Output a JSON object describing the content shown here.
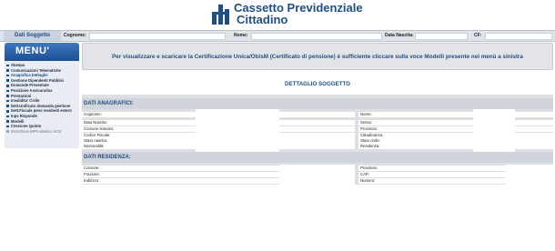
{
  "app": {
    "title_line1": "Cassetto Previdenziale",
    "title_line2": "Cittadino"
  },
  "searchbar": {
    "tab_label": "Dati Soggetto",
    "fields": [
      {
        "label": "Cognome:",
        "value": ""
      },
      {
        "label": "Nome:",
        "value": ""
      },
      {
        "label": "Data Nascita:",
        "value": ""
      },
      {
        "label": "CF:",
        "value": ""
      }
    ]
  },
  "sidebar": {
    "title": "MENU'",
    "items": [
      {
        "label": "Stampa",
        "state": "normal"
      },
      {
        "label": "Comunicazioni Telematiche",
        "state": "normal"
      },
      {
        "label": "Anagrafica Dettaglio",
        "state": "active"
      },
      {
        "label": "Gestione Dipendenti Pubblici",
        "state": "normal"
      },
      {
        "label": "Domande Presentate",
        "state": "normal"
      },
      {
        "label": "Posizione Assicurativa",
        "state": "normal"
      },
      {
        "label": "Prestazioni",
        "state": "normal"
      },
      {
        "label": "Invalidita' Civile",
        "state": "normal"
      },
      {
        "label": "Dett.Unificato domanda gestione",
        "state": "normal"
      },
      {
        "label": "Dett.Fiscale pens residenti estero",
        "state": "normal"
      },
      {
        "label": "Inps Risponde",
        "state": "normal"
      },
      {
        "label": "Modelli",
        "state": "normal"
      },
      {
        "label": "Cessione Quinto",
        "state": "normal"
      },
      {
        "label": "Estrattore INPS-Medici ACN",
        "state": "disabled"
      }
    ]
  },
  "notice": "Per visualizzare e scaricare la Certificazione Unica/ObisM (Certificato di pensione) è sufficiente cliccare sulla voce Modelli presente nel menù a sinistra",
  "detail": {
    "title": "DETTAGLIO SOGGETTO",
    "anagrafici": {
      "header": "DATI ANAGRAFICI:",
      "left": [
        "Cognome:",
        "Data Nascita:",
        "Comune Nascita:",
        "Codice Fiscale:",
        "Stato nascita:",
        "Nazionalità:"
      ],
      "right": [
        "Nome:",
        "Sesso:",
        "Provincia:",
        "Cittadinanza:",
        "Stato civile:",
        "Residenza:"
      ]
    },
    "residenza": {
      "header": "DATI RESIDENZA:",
      "left": [
        "Comune:",
        "Frazione:",
        "Indirizzo:"
      ],
      "right": [
        "Provincia:",
        "CAP:",
        "Numero:"
      ]
    }
  }
}
